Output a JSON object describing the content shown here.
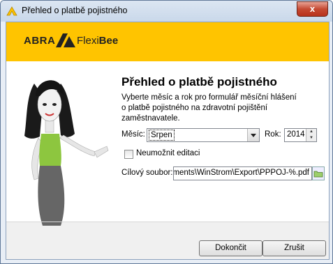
{
  "window": {
    "title": "Přehled o platbě pojistného",
    "close_glyph": "x"
  },
  "brand": {
    "abra": "ABRA",
    "flexi": "Flexi",
    "bee": "Bee",
    "color": "#ffc400"
  },
  "main": {
    "heading": "Přehled o platbě pojistného",
    "description_line1": "Vyberte měsíc a rok pro formulář měsíční hlášení",
    "description_line2": "o platbě pojistného na zdravotní pojištění zaměstnavatele."
  },
  "form": {
    "month_label": "Měsíc:",
    "month_value": "Srpen",
    "year_label": "Rok:",
    "year_value": "2014",
    "disable_edit_label": "Neumožnit editaci",
    "disable_edit_checked": false,
    "target_file_label": "Cílový soubor:",
    "target_file_value": "C:\\Users\\Documents\\WinStrom\\Export\\PPPOJ-%.pdf"
  },
  "footer": {
    "finish_label": "Dokončit",
    "cancel_label": "Zrušit"
  }
}
